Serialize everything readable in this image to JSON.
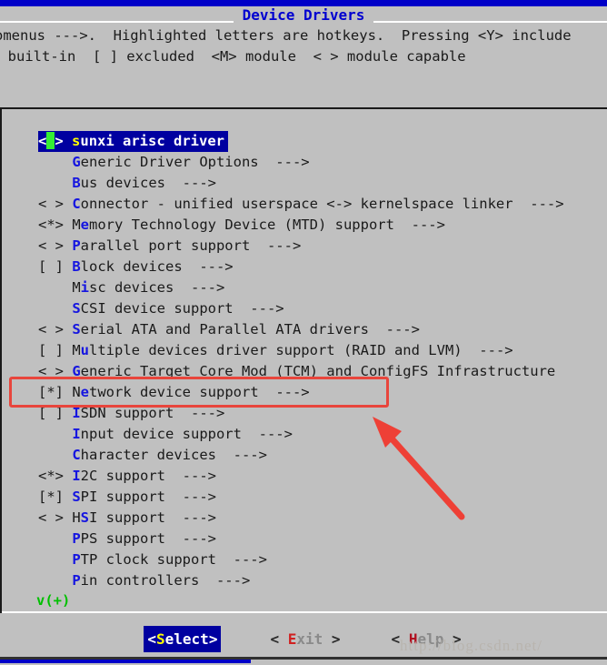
{
  "window": {
    "title": "Device Drivers"
  },
  "legend": {
    "line1": "omenus --->.  Highlighted letters are hotkeys.  Pressing <Y> include",
    "line2": "] built-in  [ ] excluded  <M> module  < > module capable"
  },
  "menu": {
    "scroll_indicator": "v(+)",
    "items": [
      {
        "marker": "< >",
        "hot": "s",
        "rest": "unxi arisc driver",
        "suffix": "",
        "selected": true,
        "cursor": true
      },
      {
        "marker": "   ",
        "hot": "G",
        "rest": "eneric Driver Options",
        "suffix": "  --->",
        "selected": false
      },
      {
        "marker": "   ",
        "hot": "B",
        "rest": "us devices",
        "suffix": "  --->",
        "selected": false
      },
      {
        "marker": "< >",
        "hot": "C",
        "rest": "onnector - unified userspace <-> kernelspace linker",
        "suffix": "  --->",
        "selected": false
      },
      {
        "marker": "<*>",
        "hot": "Me",
        "rest": "mory Technology Device (MTD) support",
        "suffix": "  --->",
        "selected": false,
        "hotstart": 1
      },
      {
        "marker": "< >",
        "hot": "P",
        "rest": "arallel port support",
        "suffix": "  --->",
        "selected": false
      },
      {
        "marker": "[ ]",
        "hot": "B",
        "rest": "lock devices",
        "suffix": "  --->",
        "selected": false
      },
      {
        "marker": "   ",
        "hot": "Mi",
        "rest": "sc devices",
        "suffix": "  --->",
        "selected": false,
        "hotstart": 1
      },
      {
        "marker": "   ",
        "hot": "S",
        "rest": "CSI device support",
        "suffix": "  --->",
        "selected": false
      },
      {
        "marker": "< >",
        "hot": "S",
        "rest": "erial ATA and Parallel ATA drivers",
        "suffix": "  --->",
        "selected": false
      },
      {
        "marker": "[ ]",
        "hot": "Mu",
        "rest": "ltiple devices driver support (RAID and LVM)",
        "suffix": "  --->",
        "selected": false,
        "hotstart": 1
      },
      {
        "marker": "< >",
        "hot": "G",
        "rest": "eneric Target Core Mod (TCM) and ConfigFS Infrastructure",
        "suffix": "",
        "selected": false
      },
      {
        "marker": "[*]",
        "hot": "Ne",
        "rest": "twork device support",
        "suffix": "  --->",
        "selected": false,
        "hotstart": 1
      },
      {
        "marker": "[ ]",
        "hot": "I",
        "rest": "SDN support",
        "suffix": "  --->",
        "selected": false
      },
      {
        "marker": "   ",
        "hot": "I",
        "rest": "nput device support",
        "suffix": "  --->",
        "selected": false
      },
      {
        "marker": "   ",
        "hot": "C",
        "rest": "haracter devices",
        "suffix": "  --->",
        "selected": false
      },
      {
        "marker": "<*>",
        "hot": "I",
        "rest": "2C support",
        "suffix": "  --->",
        "selected": false
      },
      {
        "marker": "[*]",
        "hot": "S",
        "rest": "PI support",
        "suffix": "  --->",
        "selected": false
      },
      {
        "marker": "< >",
        "hot": "HS",
        "rest": "I support",
        "suffix": "  --->",
        "selected": false,
        "hotstart": 1
      },
      {
        "marker": "   ",
        "hot": "P",
        "rest": "PS support",
        "suffix": "  --->",
        "selected": false
      },
      {
        "marker": "   ",
        "hot": "P",
        "rest": "TP clock support",
        "suffix": "  --->",
        "selected": false
      },
      {
        "marker": "   ",
        "hot": "P",
        "rest": "in controllers",
        "suffix": "  --->",
        "selected": false
      }
    ]
  },
  "buttons": {
    "select": {
      "open": "<",
      "hot": "S",
      "rest": "elect",
      "close": ">"
    },
    "exit": {
      "open": "<",
      "pre": " ",
      "hot": "E",
      "rest": "xit",
      "close": " >"
    },
    "help": {
      "open": "<",
      "pre": " ",
      "hot": "H",
      "rest": "elp",
      "close": " >"
    }
  },
  "annotations": {
    "highlight_target": "Network device support",
    "box_color": "#e8453c",
    "arrow_color": "#ee4036"
  },
  "watermark": {
    "text": "http://blog.csdn.net/"
  }
}
